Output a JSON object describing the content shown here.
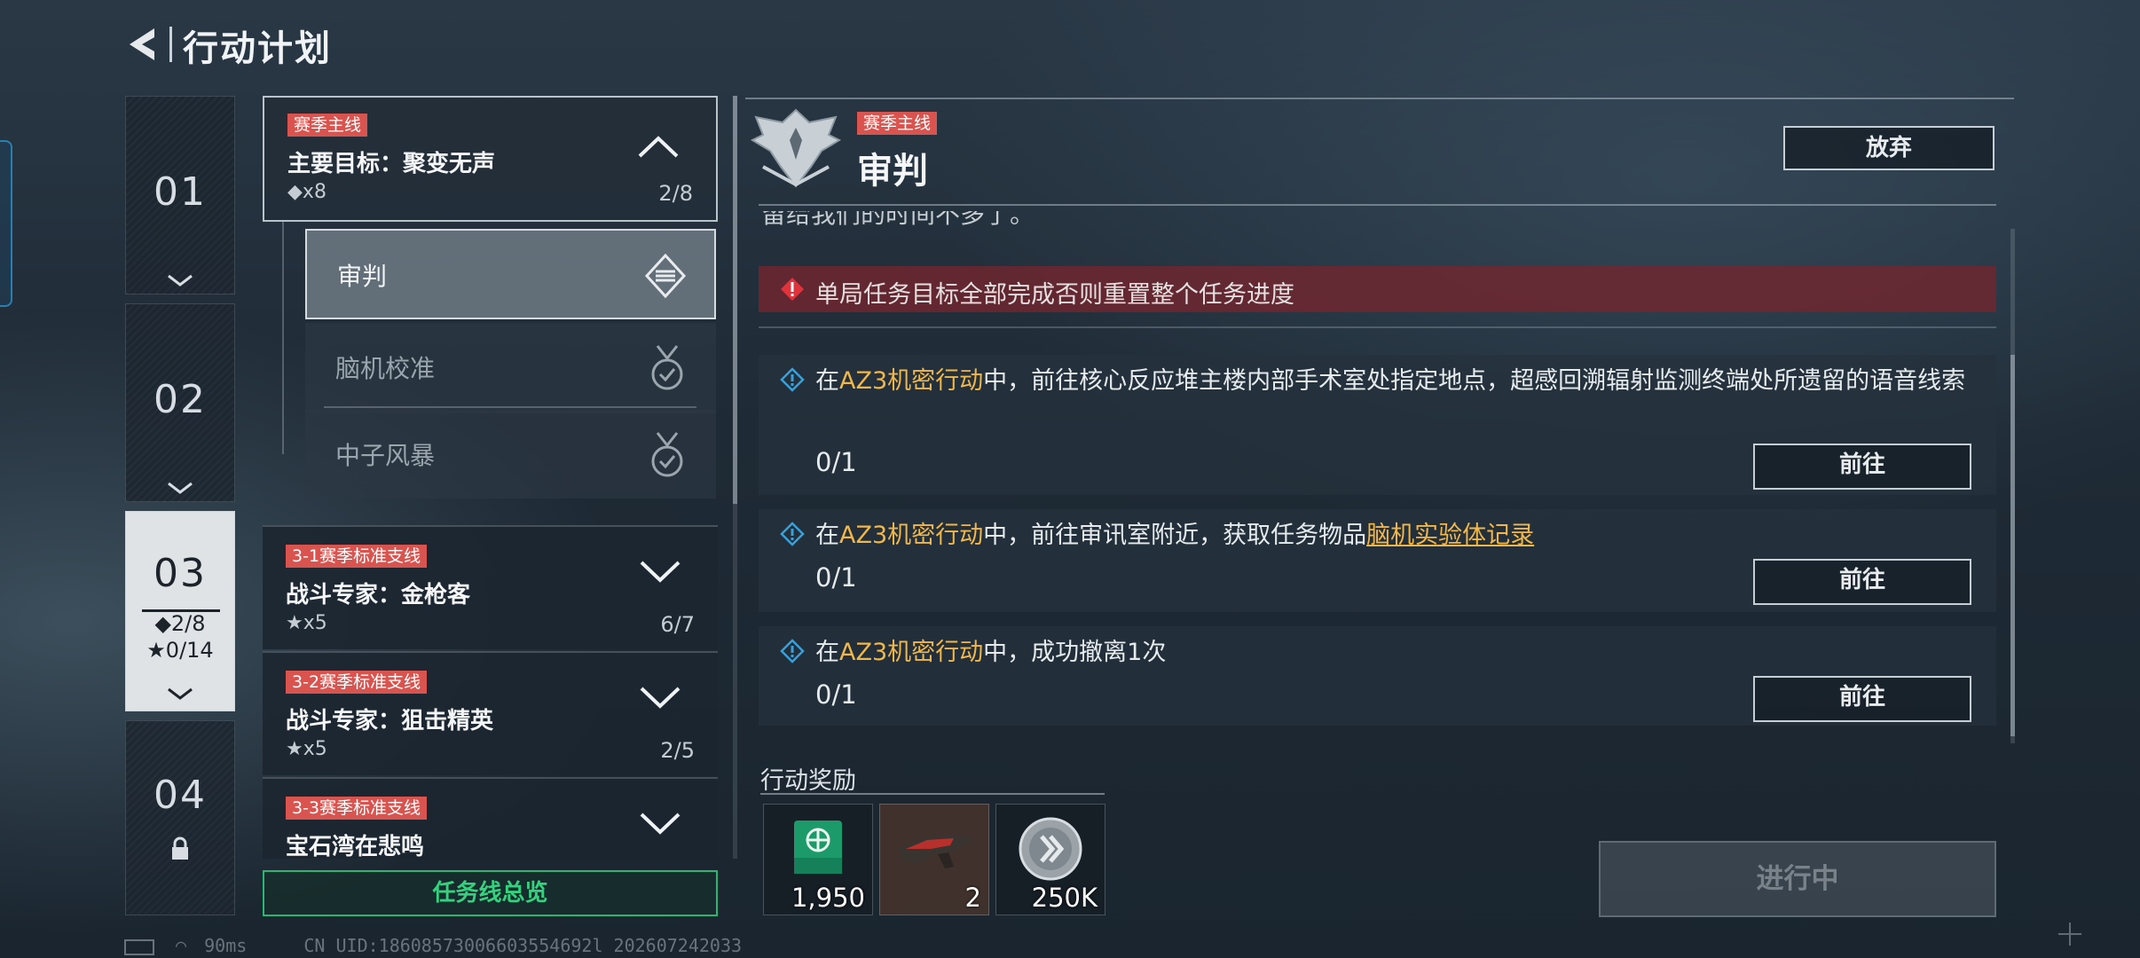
{
  "header": {
    "title": "行动计划"
  },
  "chapters": [
    {
      "num": "01"
    },
    {
      "num": "02"
    },
    {
      "num": "03",
      "main_progress": "◆2/8",
      "side_progress": "★0/14"
    },
    {
      "num": "04"
    }
  ],
  "mission_list": {
    "main": {
      "tag": "赛季主线",
      "title": "主要目标：聚变无声",
      "sub": "◆x8",
      "count": "2/8"
    },
    "subitems": [
      "审判",
      "脑机校准",
      "中子风暴"
    ],
    "side": [
      {
        "tag": "3-1赛季标准支线",
        "title": "战斗专家：金枪客",
        "sub": "★x5",
        "count": "6/7"
      },
      {
        "tag": "3-2赛季标准支线",
        "title": "战斗专家：狙击精英",
        "sub": "★x5",
        "count": "2/5"
      },
      {
        "tag": "3-3赛季标准支线",
        "title": "宝石湾在悲鸣"
      }
    ],
    "overview_button": "任务线总览"
  },
  "detail": {
    "tag": "赛季主线",
    "title": "审判",
    "quit_button": "放弃",
    "cut_text": "留给我们的时间不多了。",
    "warning": "单局任务目标全部完成否则重置整个任务进度",
    "tasks": [
      {
        "pre": "在",
        "op": "AZ3机密行动",
        "post": "中，前往核心反应堆主楼内部手术室处指定地点，超感回溯辐射监测终端处所遗留的语音线索",
        "progress": "0/1",
        "button": "前往"
      },
      {
        "pre": "在",
        "op": "AZ3机密行动",
        "post": "中，前往审讯室附近，获取任务物品",
        "link": "脑机实验体记录",
        "progress": "0/1",
        "button": "前往"
      },
      {
        "pre": "在",
        "op": "AZ3机密行动",
        "post": "中，成功撤离1次",
        "progress": "0/1",
        "button": "前往"
      }
    ],
    "reward_label": "行动奖励",
    "rewards": [
      {
        "icon": "supply-crate-icon",
        "qty": "1,950"
      },
      {
        "icon": "weapon-skin-icon",
        "qty": "2"
      },
      {
        "icon": "coin-icon",
        "qty": "250K"
      }
    ],
    "status_button": "进行中"
  },
  "footer": {
    "ping": "90ms",
    "uid": "CN UID:18608573006603554692l 202607242033"
  }
}
